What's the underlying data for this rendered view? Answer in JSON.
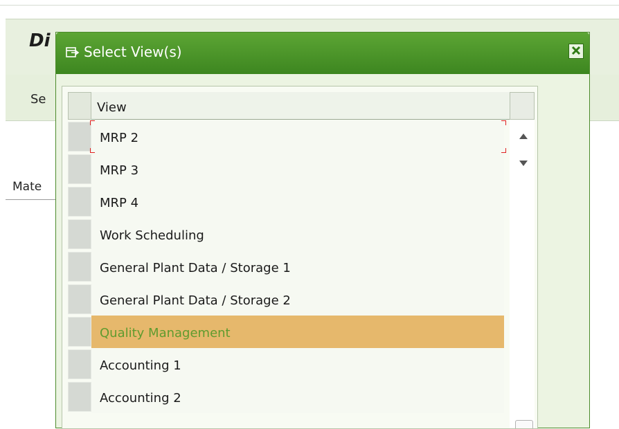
{
  "background": {
    "title_fragment": "Di",
    "toolbar_fragment": "Se",
    "field_label_fragment": "Mate"
  },
  "dialog": {
    "title": "Select View(s)",
    "title_icon": "select-view-icon",
    "close_icon": "close-icon",
    "table": {
      "column_header": "View",
      "rows": [
        {
          "label": "MRP 2",
          "focused": true
        },
        {
          "label": "MRP 3"
        },
        {
          "label": "MRP 4"
        },
        {
          "label": "Work Scheduling"
        },
        {
          "label": "General Plant Data / Storage 1"
        },
        {
          "label": "General Plant Data / Storage 2"
        },
        {
          "label": "Quality Management",
          "selected": true
        },
        {
          "label": "Accounting 1"
        },
        {
          "label": "Accounting 2"
        }
      ]
    }
  },
  "colors": {
    "titlebar_green": "#4a9428",
    "dialog_bg": "#ecf4e2",
    "selected_row_bg": "#e6b86c",
    "selected_row_text": "#5f9b2f",
    "focus_mark": "#e02020"
  }
}
